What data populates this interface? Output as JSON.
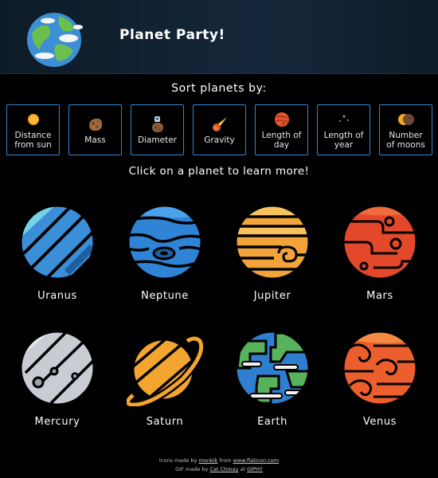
{
  "header": {
    "title": "Planet Party!",
    "logo_icon": "earth-icon"
  },
  "sort": {
    "heading": "Sort planets by:",
    "options": [
      {
        "label": "Distance\nfrom sun",
        "icon": "sun-icon"
      },
      {
        "label": "Mass",
        "icon": "asteroid-icon"
      },
      {
        "label": "Diameter",
        "icon": "astronaut-asteroid-icon"
      },
      {
        "label": "Gravity",
        "icon": "comet-icon"
      },
      {
        "label": "Length of\nday",
        "icon": "mars-planet-icon"
      },
      {
        "label": "Length of\nyear",
        "icon": "stars-icon"
      },
      {
        "label": "Number\nof moons",
        "icon": "moons-icon"
      }
    ]
  },
  "learn_heading": "Click on a planet to learn more!",
  "planets": [
    {
      "name": "Uranus"
    },
    {
      "name": "Neptune"
    },
    {
      "name": "Jupiter"
    },
    {
      "name": "Mars"
    },
    {
      "name": "Mercury"
    },
    {
      "name": "Saturn"
    },
    {
      "name": "Earth"
    },
    {
      "name": "Venus"
    }
  ],
  "footer": {
    "line1_a": "Icons made by",
    "line1_author": "monkik",
    "line1_b": "from",
    "line1_site": "www.flaticon.com",
    "line2_a": "GIF made by",
    "line2_author": "Cat Chmay",
    "line2_b": "at",
    "line2_site": "GIPHY"
  },
  "colors": {
    "accent_border": "#2e87d6",
    "uranus": "#3b8fd9",
    "neptune": "#2f84d6",
    "jupiter": "#f2a43a",
    "mars": "#e3482b",
    "mercury": "#c9cdd3",
    "saturn": "#f3a52f",
    "earth_ocean": "#2f7fd0",
    "earth_land": "#58b25b",
    "venus": "#ec5f2c"
  }
}
